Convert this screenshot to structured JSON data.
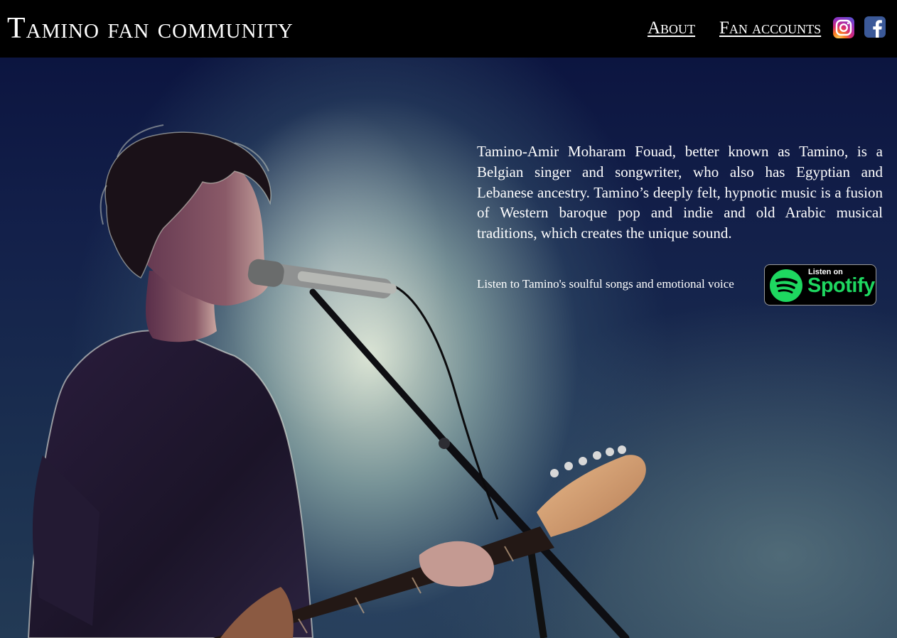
{
  "header": {
    "site_title": "Tamino fan community",
    "nav": [
      {
        "label": "About"
      },
      {
        "label": "Fan accounts"
      }
    ],
    "social": [
      {
        "icon": "instagram-icon"
      },
      {
        "icon": "facebook-icon"
      }
    ]
  },
  "hero": {
    "photo": "tamino-singing-with-guitar-photo",
    "bio": "Tamino-Amir Moharam Fouad, better known as Tamino, is a Belgian singer and songwriter, who also has Egyptian and Lebanese ancestry. Tamino’s deeply felt, hypnotic music is a fusion of Western baroque pop and indie and old Arabic musical traditions, which creates the unique sound.",
    "listen_text": "Listen to Tamino's soulful songs and emotional voice",
    "spotify_badge": {
      "small_label": "Listen on",
      "brand_label": "Spotify",
      "icon": "spotify-icon"
    }
  },
  "colors": {
    "header_bg": "#000000",
    "spotify_green": "#1ed760",
    "text": "#ffffff"
  }
}
